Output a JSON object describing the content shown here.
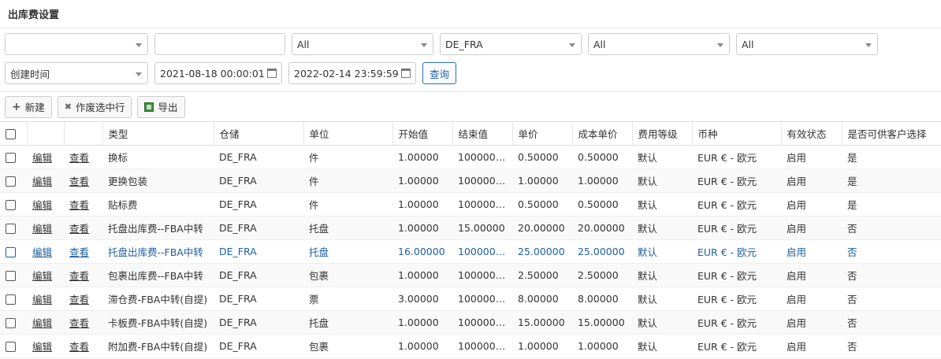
{
  "page_title": "出库费设置",
  "filters": {
    "row1": [
      {
        "type": "select",
        "value": "",
        "name": "filter-select-1"
      },
      {
        "type": "input",
        "value": "",
        "name": "filter-text-input"
      },
      {
        "type": "select",
        "value": "All",
        "name": "filter-select-2"
      },
      {
        "type": "select",
        "value": "DE_FRA",
        "name": "warehouse-select"
      },
      {
        "type": "select",
        "value": "All",
        "name": "filter-select-3"
      },
      {
        "type": "select",
        "value": "All",
        "name": "filter-select-4"
      }
    ],
    "time_type": "创建时间",
    "start_date": "2021-08-18 00:00:01",
    "end_date": "2022-02-14 23:59:59",
    "query_label": "查询"
  },
  "toolbar": {
    "new_label": "新建",
    "void_label": "作废选中行",
    "export_label": "导出"
  },
  "table": {
    "columns": [
      "",
      "",
      "",
      "类型",
      "仓储",
      "单位",
      "开始值",
      "结束值",
      "单价",
      "成本单价",
      "费用等级",
      "币种",
      "有效状态",
      "是否可供客户选择"
    ],
    "rows": [
      [
        "编辑",
        "查看",
        "换标",
        "DE_FRA",
        "件",
        "1.00000",
        "100000…",
        "0.50000",
        "0.50000",
        "默认",
        "EUR € - 欧元",
        "启用",
        "是"
      ],
      [
        "编辑",
        "查看",
        "更换包装",
        "DE_FRA",
        "件",
        "1.00000",
        "100000…",
        "1.00000",
        "1.00000",
        "默认",
        "EUR € - 欧元",
        "启用",
        "是"
      ],
      [
        "编辑",
        "查看",
        "贴标费",
        "DE_FRA",
        "件",
        "1.00000",
        "100000…",
        "0.50000",
        "0.50000",
        "默认",
        "EUR € - 欧元",
        "启用",
        "是"
      ],
      [
        "编辑",
        "查看",
        "托盘出库费--FBA中转",
        "DE_FRA",
        "托盘",
        "1.00000",
        "15.00000",
        "20.00000",
        "20.00000",
        "默认",
        "EUR € - 欧元",
        "启用",
        "否"
      ],
      [
        "编辑",
        "查看",
        "托盘出库费--FBA中转",
        "DE_FRA",
        "托盘",
        "16.00000",
        "100000…",
        "25.00000",
        "25.00000",
        "默认",
        "EUR € - 欧元",
        "启用",
        "否"
      ],
      [
        "编辑",
        "查看",
        "包裹出库费--FBA中转",
        "DE_FRA",
        "包裹",
        "1.00000",
        "100000…",
        "2.50000",
        "2.50000",
        "默认",
        "EUR € - 欧元",
        "启用",
        "否"
      ],
      [
        "编辑",
        "查看",
        "滞仓费-FBA中转(自提)",
        "DE_FRA",
        "票",
        "3.00000",
        "100000…",
        "8.00000",
        "8.00000",
        "默认",
        "EUR € - 欧元",
        "启用",
        "否"
      ],
      [
        "编辑",
        "查看",
        "卡板费-FBA中转(自提)",
        "DE_FRA",
        "托盘",
        "1.00000",
        "100000…",
        "15.00000",
        "15.00000",
        "默认",
        "EUR € - 欧元",
        "启用",
        "否"
      ],
      [
        "编辑",
        "查看",
        "附加费-FBA中转(自提)",
        "DE_FRA",
        "包裹",
        "1.00000",
        "100000…",
        "1.00000",
        "1.00000",
        "默认",
        "EUR € - 欧元",
        "启用",
        "否"
      ]
    ],
    "selected_row": 4
  }
}
